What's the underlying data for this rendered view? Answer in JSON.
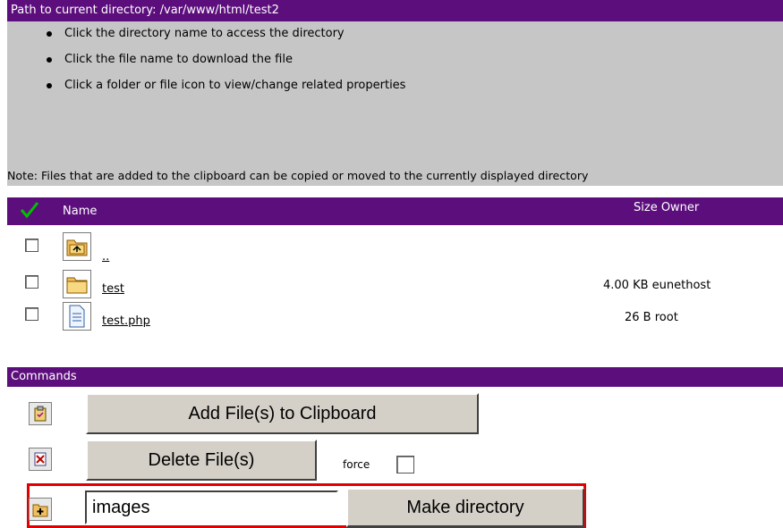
{
  "path_bar": {
    "label": "Path to current directory: /var/www/html/test2"
  },
  "instructions": [
    "Click the directory name to access the directory",
    "Click the file name to download the file",
    "Click a folder or file icon to view/change related properties"
  ],
  "note": "Note: Files that are added to the clipboard can be copied or moved to the currently displayed directory",
  "files_table": {
    "header_name": "Name",
    "header_size_owner": "Size Owner",
    "rows": [
      {
        "name": "..",
        "icon": "parent-folder-icon",
        "size": "",
        "owner": ""
      },
      {
        "name": "test",
        "icon": "folder-icon",
        "size": "4.00 KB",
        "owner": "eunethost"
      },
      {
        "name": "test.php",
        "icon": "file-icon",
        "size": "26 B",
        "owner": "root"
      }
    ]
  },
  "commands": {
    "title": "Commands",
    "add_clipboard_label": "Add File(s) to Clipboard",
    "delete_label": "Delete File(s)",
    "force_label": "force",
    "mkdir_value": "images",
    "mkdir_button_label": "Make directory"
  },
  "colors": {
    "header_bg": "#5c0f7c",
    "info_bg": "#c6c6c6",
    "highlight": "#e00000"
  }
}
